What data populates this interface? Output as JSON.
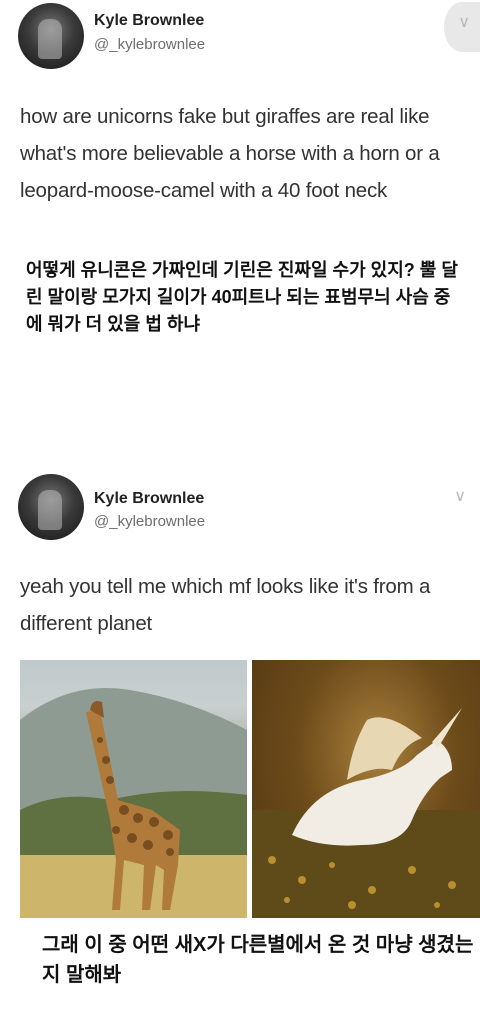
{
  "tweet1": {
    "name": "Kyle Brownlee",
    "handle": "@_kylebrownlee",
    "text": "how are unicorns fake but giraffes are real like what's more believable a horse with a horn or a leopard-moose-camel with a 40 foot neck",
    "translation": "어떻게 유니콘은 가짜인데 기린은 진짜일 수가 있지? 뿔 달린 말이랑 모가지 길이가 40피트나 되는 표범무늬 사슴 중에 뭐가 더 있을 법 하냐"
  },
  "tweet2": {
    "name": "Kyle Brownlee",
    "handle": "@_kylebrownlee",
    "text": "yeah you tell me which mf looks like it's from a different planet"
  },
  "caption": "그래 이 중 어떤 새X가 다른별에서 온 것 마냥 생겼는지 말해봐",
  "icons": {
    "avatar": "avatar-photo",
    "menu": "chevron-down-icon"
  }
}
